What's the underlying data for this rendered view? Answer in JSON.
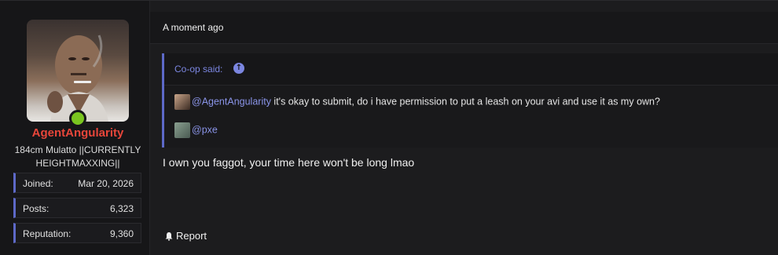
{
  "user": {
    "name": "AgentAngularity",
    "title": "184cm Mulatto ||CURRENTLY HEIGHTMAXXING||",
    "online": true,
    "name_color": "#e8463a",
    "stats": [
      {
        "label": "Joined:",
        "value": "Mar 20, 2026"
      },
      {
        "label": "Posts:",
        "value": "6,323"
      },
      {
        "label": "Reputation:",
        "value": "9,360"
      }
    ]
  },
  "post": {
    "timestamp": "A moment ago",
    "quote": {
      "author": "Co-op said:",
      "up_icon": "arrow-up-circle-icon",
      "line1_mention": "@AgentAngularity",
      "line1_text": " it's okay to submit, do i have permission to put a leash on your avi and use it as my own?",
      "line2_mention": "@pxe"
    },
    "body": "I own you faggot, your time here won't be long lmao",
    "report_label": "Report",
    "report_icon": "bell-icon"
  },
  "colors": {
    "accent": "#5d69c8",
    "mention": "#8a94e8",
    "online": "#7ac520"
  }
}
